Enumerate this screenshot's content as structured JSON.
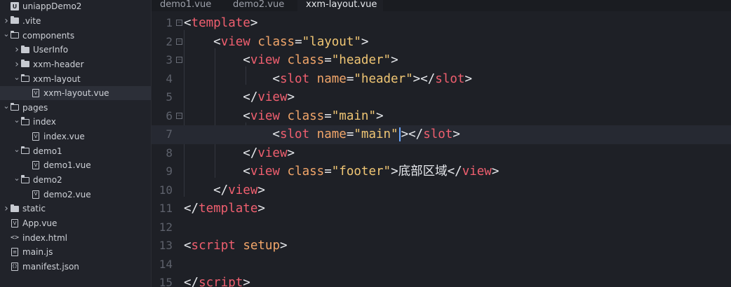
{
  "sidebar": {
    "items": [
      {
        "label": "uniappDemo2",
        "level": 0,
        "chevron": "",
        "icon": "project-icon",
        "selected": false
      },
      {
        "label": ".vite",
        "level": 0,
        "chevron": "right",
        "icon": "folder-icon",
        "selected": false
      },
      {
        "label": "components",
        "level": 0,
        "chevron": "down",
        "icon": "folder-open-icon",
        "selected": false
      },
      {
        "label": "UserInfo",
        "level": 1,
        "chevron": "right",
        "icon": "folder-icon",
        "selected": false
      },
      {
        "label": "xxm-header",
        "level": 1,
        "chevron": "right",
        "icon": "folder-icon",
        "selected": false
      },
      {
        "label": "xxm-layout",
        "level": 1,
        "chevron": "down",
        "icon": "folder-open-icon",
        "selected": false
      },
      {
        "label": "xxm-layout.vue",
        "level": 2,
        "chevron": "",
        "icon": "vue-file-icon",
        "selected": true
      },
      {
        "label": "pages",
        "level": 0,
        "chevron": "down",
        "icon": "folder-open-icon",
        "selected": false
      },
      {
        "label": "index",
        "level": 1,
        "chevron": "down",
        "icon": "folder-open-icon",
        "selected": false
      },
      {
        "label": "index.vue",
        "level": 2,
        "chevron": "",
        "icon": "vue-file-icon",
        "selected": false
      },
      {
        "label": "demo1",
        "level": 1,
        "chevron": "down",
        "icon": "folder-open-icon",
        "selected": false
      },
      {
        "label": "demo1.vue",
        "level": 2,
        "chevron": "",
        "icon": "vue-file-icon",
        "selected": false
      },
      {
        "label": "demo2",
        "level": 1,
        "chevron": "down",
        "icon": "folder-open-icon",
        "selected": false
      },
      {
        "label": "demo2.vue",
        "level": 2,
        "chevron": "",
        "icon": "vue-file-icon",
        "selected": false
      },
      {
        "label": "static",
        "level": 0,
        "chevron": "right",
        "icon": "folder-icon",
        "selected": false
      },
      {
        "label": "App.vue",
        "level": 0,
        "chevron": "",
        "icon": "vue-file-icon",
        "selected": false
      },
      {
        "label": "index.html",
        "level": 0,
        "chevron": "",
        "icon": "html-file-icon",
        "selected": false
      },
      {
        "label": "main.js",
        "level": 0,
        "chevron": "",
        "icon": "js-file-icon",
        "selected": false
      },
      {
        "label": "manifest.json",
        "level": 0,
        "chevron": "",
        "icon": "json-file-icon",
        "selected": false
      }
    ]
  },
  "tabs": [
    {
      "label": "demo1.vue",
      "active": false
    },
    {
      "label": "demo2.vue",
      "active": false
    },
    {
      "label": "xxm-layout.vue",
      "active": true
    }
  ],
  "editor": {
    "current_line": 7,
    "lines": [
      {
        "n": "1",
        "fold": true,
        "tokens": [
          [
            "p",
            "<"
          ],
          [
            "tag",
            "template"
          ],
          [
            "p",
            ">"
          ]
        ]
      },
      {
        "n": "2",
        "fold": true,
        "tokens": [
          [
            "p",
            "    <"
          ],
          [
            "tag",
            "view"
          ],
          [
            "p",
            " "
          ],
          [
            "attr",
            "class"
          ],
          [
            "p",
            "="
          ],
          [
            "str",
            "\"layout\""
          ],
          [
            "p",
            ">"
          ]
        ]
      },
      {
        "n": "3",
        "fold": true,
        "tokens": [
          [
            "p",
            "        <"
          ],
          [
            "tag",
            "view"
          ],
          [
            "p",
            " "
          ],
          [
            "attr",
            "class"
          ],
          [
            "p",
            "="
          ],
          [
            "str",
            "\"header\""
          ],
          [
            "p",
            ">"
          ]
        ]
      },
      {
        "n": "4",
        "fold": false,
        "tokens": [
          [
            "p",
            "            <"
          ],
          [
            "tag",
            "slot"
          ],
          [
            "p",
            " "
          ],
          [
            "attr",
            "name"
          ],
          [
            "p",
            "="
          ],
          [
            "str",
            "\"header\""
          ],
          [
            "p",
            "></"
          ],
          [
            "tag",
            "slot"
          ],
          [
            "p",
            ">"
          ]
        ]
      },
      {
        "n": "5",
        "fold": false,
        "tokens": [
          [
            "p",
            "        </"
          ],
          [
            "tag",
            "view"
          ],
          [
            "p",
            ">"
          ]
        ]
      },
      {
        "n": "6",
        "fold": true,
        "tokens": [
          [
            "p",
            "        <"
          ],
          [
            "tag",
            "view"
          ],
          [
            "p",
            " "
          ],
          [
            "attr",
            "class"
          ],
          [
            "p",
            "="
          ],
          [
            "str",
            "\"main\""
          ],
          [
            "p",
            ">"
          ]
        ]
      },
      {
        "n": "7",
        "fold": false,
        "tokens": [
          [
            "p",
            "            <"
          ],
          [
            "tag",
            "slot"
          ],
          [
            "p",
            " "
          ],
          [
            "attr",
            "name"
          ],
          [
            "p",
            "="
          ],
          [
            "str",
            "\"main\""
          ],
          [
            "cursor",
            ""
          ],
          [
            "p",
            "></"
          ],
          [
            "tag",
            "slot"
          ],
          [
            "p",
            ">"
          ]
        ]
      },
      {
        "n": "8",
        "fold": false,
        "tokens": [
          [
            "p",
            "        </"
          ],
          [
            "tag",
            "view"
          ],
          [
            "p",
            ">"
          ]
        ]
      },
      {
        "n": "9",
        "fold": false,
        "tokens": [
          [
            "p",
            "        <"
          ],
          [
            "tag",
            "view"
          ],
          [
            "p",
            " "
          ],
          [
            "attr",
            "class"
          ],
          [
            "p",
            "="
          ],
          [
            "str",
            "\"footer\""
          ],
          [
            "p",
            ">"
          ],
          [
            "txt",
            "底部区域"
          ],
          [
            "p",
            "</"
          ],
          [
            "tag",
            "view"
          ],
          [
            "p",
            ">"
          ]
        ]
      },
      {
        "n": "10",
        "fold": false,
        "tokens": [
          [
            "p",
            "    </"
          ],
          [
            "tag",
            "view"
          ],
          [
            "p",
            ">"
          ]
        ]
      },
      {
        "n": "11",
        "fold": false,
        "tokens": [
          [
            "p",
            "</"
          ],
          [
            "tag",
            "template"
          ],
          [
            "p",
            ">"
          ]
        ]
      },
      {
        "n": "12",
        "fold": false,
        "tokens": []
      },
      {
        "n": "13",
        "fold": false,
        "tokens": [
          [
            "p",
            "<"
          ],
          [
            "tag",
            "script"
          ],
          [
            "p",
            " "
          ],
          [
            "attr",
            "setup"
          ],
          [
            "p",
            ">"
          ]
        ]
      },
      {
        "n": "14",
        "fold": false,
        "tokens": []
      },
      {
        "n": "15",
        "fold": false,
        "tokens": [
          [
            "p",
            "</"
          ],
          [
            "tag",
            "script"
          ],
          [
            "p",
            ">"
          ]
        ]
      }
    ]
  },
  "colors": {
    "tag": "#f05f6f",
    "attr": "#f2a66a",
    "string": "#f0c674",
    "punctuation": "#e6e8ec",
    "cursor": "#6aa6ff"
  }
}
